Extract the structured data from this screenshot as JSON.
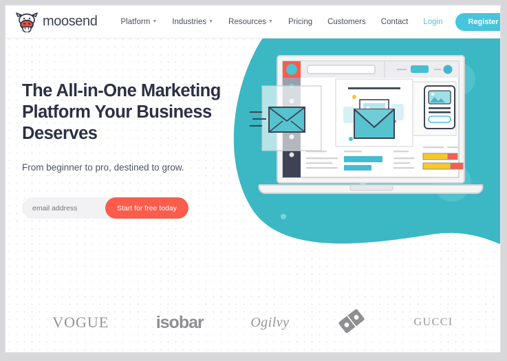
{
  "brand": {
    "name": "moosend",
    "logo_icon": "cow-head-icon"
  },
  "nav": {
    "items": [
      {
        "label": "Platform",
        "has_dropdown": true
      },
      {
        "label": "Industries",
        "has_dropdown": true
      },
      {
        "label": "Resources",
        "has_dropdown": true
      },
      {
        "label": "Pricing",
        "has_dropdown": false
      },
      {
        "label": "Customers",
        "has_dropdown": false
      },
      {
        "label": "Contact",
        "has_dropdown": false
      }
    ],
    "login_label": "Login",
    "register_label": "Register"
  },
  "hero": {
    "headline": "The All-in-One Marketing Platform Your Business Deserves",
    "subheadline": "From beginner to pro, destined to grow.",
    "email_placeholder": "email address",
    "email_value": "",
    "cta_label": "Start for free today",
    "illustration": "laptop-email-editor-illustration"
  },
  "logos": [
    {
      "name": "VOGUE",
      "style": "vogue"
    },
    {
      "name": "isobar",
      "style": "isobar"
    },
    {
      "name": "Ogilvy",
      "style": "ogilvy"
    },
    {
      "name": "dominos-logo-icon",
      "style": "dominos"
    },
    {
      "name": "GUCCI",
      "style": "gucci"
    }
  ],
  "colors": {
    "teal_blob": "#3bb8c3",
    "register_cyan": "#46c5dc",
    "cta_red": "#fb5c4c",
    "heading_navy": "#2b3044",
    "link_cyan": "#4fc3d6",
    "logo_gray": "#949499"
  }
}
